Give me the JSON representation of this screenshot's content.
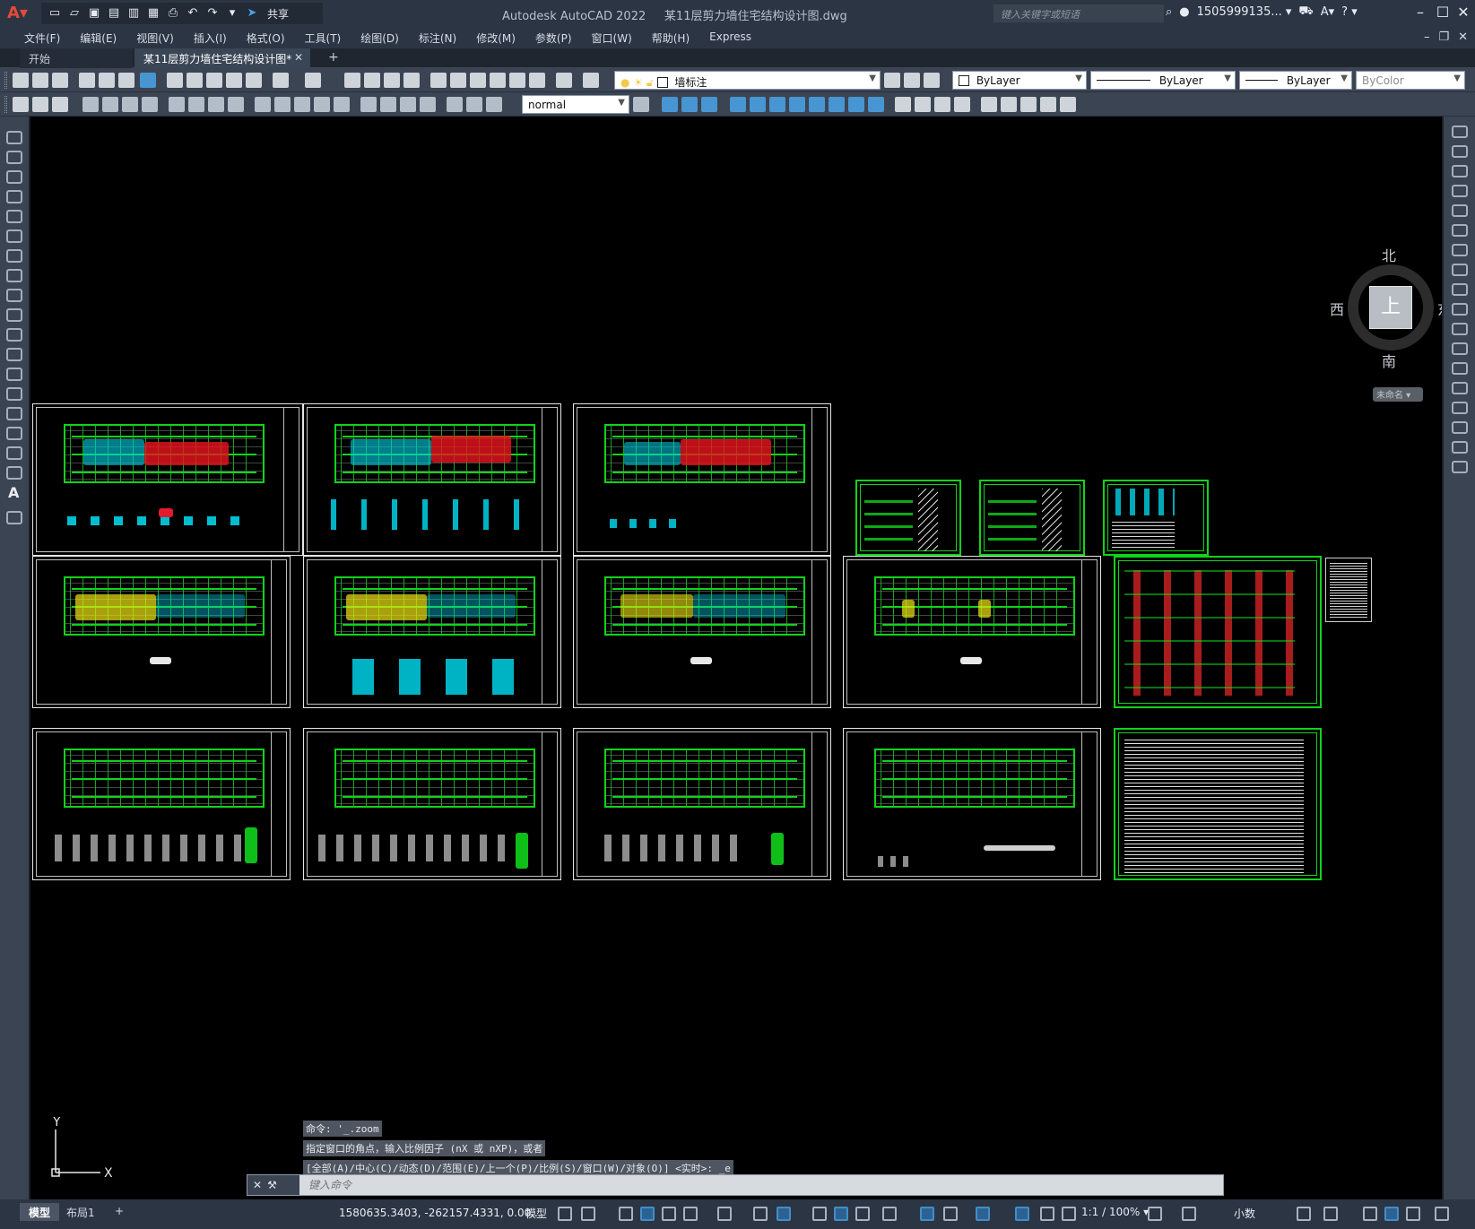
{
  "titlebar": {
    "app_title": "Autodesk AutoCAD 2022",
    "file_name": "某11层剪力墙住宅结构设计图.dwg",
    "share_label": "共享",
    "search_placeholder": "键入关键字或短语",
    "user": "1505999135... ▾",
    "help": "? ▾"
  },
  "menu": [
    "文件(F)",
    "编辑(E)",
    "视图(V)",
    "插入(I)",
    "格式(O)",
    "工具(T)",
    "绘图(D)",
    "标注(N)",
    "修改(M)",
    "参数(P)",
    "窗口(W)",
    "帮助(H)",
    "Express"
  ],
  "tabs": {
    "start": "开始",
    "document": "某11层剪力墙住宅结构设计图*",
    "add": "+"
  },
  "toolbar": {
    "layer_name": "墙标注",
    "color": "ByLayer",
    "linetype": "ByLayer",
    "lineweight": "ByLayer",
    "plotstyle": "ByColor",
    "dimstyle": "normal"
  },
  "viewcube": {
    "north": "北",
    "south": "南",
    "east": "东",
    "west": "西",
    "face": "上",
    "wcs": "未命名 ▾"
  },
  "ucs": {
    "y": "Y",
    "x": "X"
  },
  "command": {
    "history": [
      "命令: '_.zoom",
      "指定窗口的角点，输入比例因子 (nX 或 nXP)，或者",
      "[全部(A)/中心(C)/动态(D)/范围(E)/上一个(P)/比例(S)/窗口(W)/对象(O)] <实时>: _e"
    ],
    "placeholder": "键入命令"
  },
  "statusbar": {
    "layout_tabs": [
      "模型",
      "布局1"
    ],
    "add_layout": "+",
    "coordinates": "1580635.3403, -262157.4331, 0.00...",
    "model_label": "模型",
    "scale": "1:1 / 100% ▾",
    "units": "小数"
  },
  "colors": {
    "canvas": "#000000",
    "frame_green": "#11d31b",
    "titlebar": "#2b3544",
    "toolbar": "#3b4453"
  }
}
